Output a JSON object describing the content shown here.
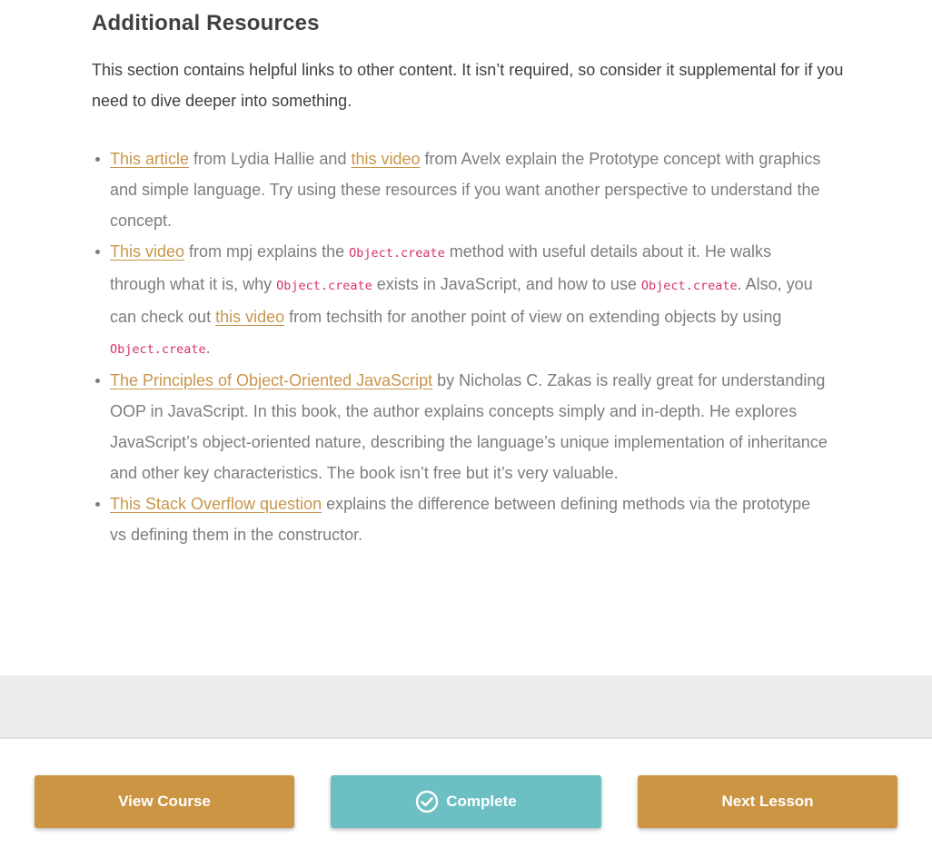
{
  "section": {
    "title": "Additional Resources",
    "intro": "This section contains helpful links to other content. It isn’t required, so consider it supplemental for if you need to dive deeper into something."
  },
  "resources": [
    {
      "segments": [
        {
          "type": "link",
          "text": "This article"
        },
        {
          "type": "text",
          "text": " from Lydia Hallie and "
        },
        {
          "type": "link",
          "text": "this video"
        },
        {
          "type": "text",
          "text": " from Avelx explain the Prototype concept with graphics and simple language. Try using these resources if you want another perspective to understand the concept."
        }
      ]
    },
    {
      "segments": [
        {
          "type": "link",
          "text": "This video"
        },
        {
          "type": "text",
          "text": " from mpj explains the "
        },
        {
          "type": "code",
          "text": "Object.create"
        },
        {
          "type": "text",
          "text": " method with useful details about it. He walks through what it is, why "
        },
        {
          "type": "code",
          "text": "Object.create"
        },
        {
          "type": "text",
          "text": " exists in JavaScript, and how to use "
        },
        {
          "type": "code",
          "text": "Object.create"
        },
        {
          "type": "text",
          "text": ". Also, you can check out "
        },
        {
          "type": "link",
          "text": "this video"
        },
        {
          "type": "text",
          "text": " from techsith for another point of view on extending objects by using "
        },
        {
          "type": "code",
          "text": "Object.create"
        },
        {
          "type": "text",
          "text": "."
        }
      ]
    },
    {
      "segments": [
        {
          "type": "link",
          "text": "The Principles of Object-Oriented JavaScript"
        },
        {
          "type": "text",
          "text": " by Nicholas C. Zakas is really great for understanding OOP in JavaScript. In this book, the author explains concepts simply and in-depth. He explores JavaScript’s object-oriented nature, describing the language’s unique implementation of inheritance and other key characteristics. The book isn’t free but it’s very valuable."
        }
      ]
    },
    {
      "segments": [
        {
          "type": "link",
          "text": "This Stack Overflow question"
        },
        {
          "type": "text",
          "text": " explains the difference between defining methods via the prototype vs defining them in the constructor."
        }
      ]
    }
  ],
  "footer": {
    "view_course_label": "View Course",
    "complete_label": "Complete",
    "complete_icon": "check-circle-icon",
    "next_lesson_label": "Next Lesson"
  },
  "colors": {
    "link": "#c8964a",
    "code": "#d6336c",
    "primary_button": "#cc9544",
    "complete_button": "#6cbfc3"
  }
}
